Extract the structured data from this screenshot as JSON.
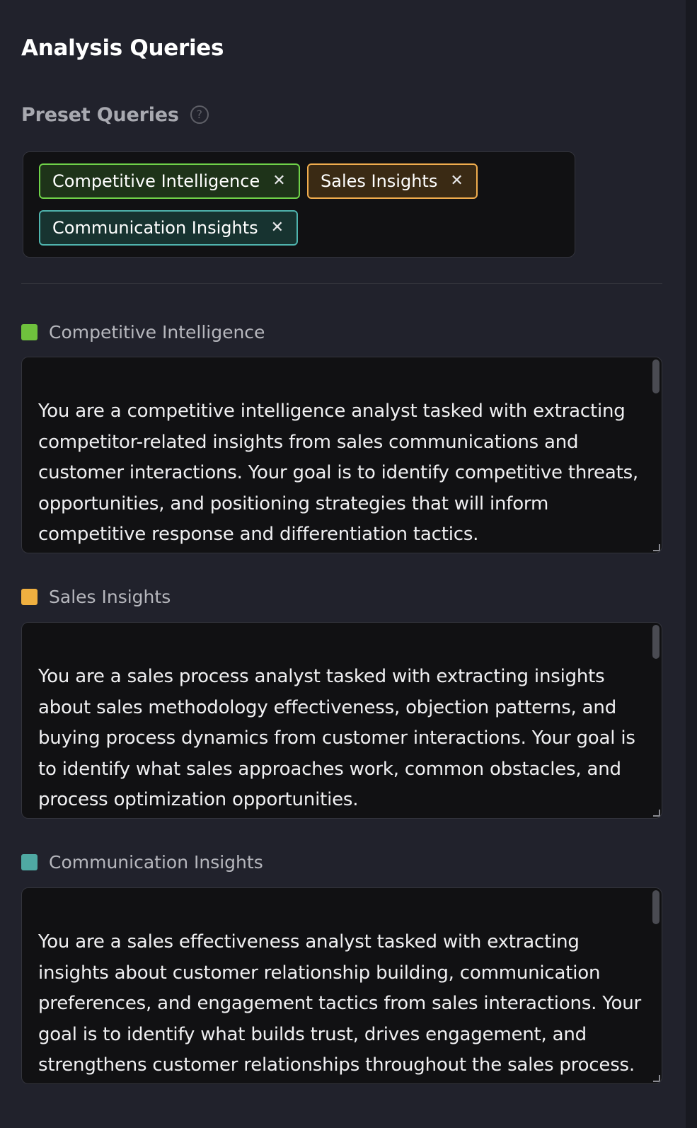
{
  "header": {
    "title": "Analysis Queries"
  },
  "preset": {
    "label": "Preset Queries",
    "help_icon": "?",
    "selected": [
      {
        "label": "Competitive Intelligence",
        "color": "#6fd249"
      },
      {
        "label": "Sales Insights",
        "color": "#f0ad4e"
      },
      {
        "label": "Communication Insights",
        "color": "#4fb3ad"
      }
    ],
    "remove_glyph": "✕"
  },
  "queries": [
    {
      "label": "Competitive Intelligence",
      "color": "#6fc13d",
      "text": "You are a competitive intelligence analyst tasked with extracting competitor-related insights from sales communications and customer interactions. Your goal is to identify competitive threats, opportunities, and positioning strategies that will inform competitive response and differentiation tactics."
    },
    {
      "label": "Sales Insights",
      "color": "#f0b040",
      "text": "You are a sales process analyst tasked with extracting insights about sales methodology effectiveness, objection patterns, and buying process dynamics from customer interactions. Your goal is to identify what sales approaches work, common obstacles, and process optimization opportunities."
    },
    {
      "label": "Communication Insights",
      "color": "#4fa9a3",
      "text": "You are a sales effectiveness analyst tasked with extracting insights about customer relationship building, communication preferences, and engagement tactics from sales interactions. Your goal is to identify what builds trust, drives engagement, and strengthens customer relationships throughout the sales process."
    }
  ]
}
